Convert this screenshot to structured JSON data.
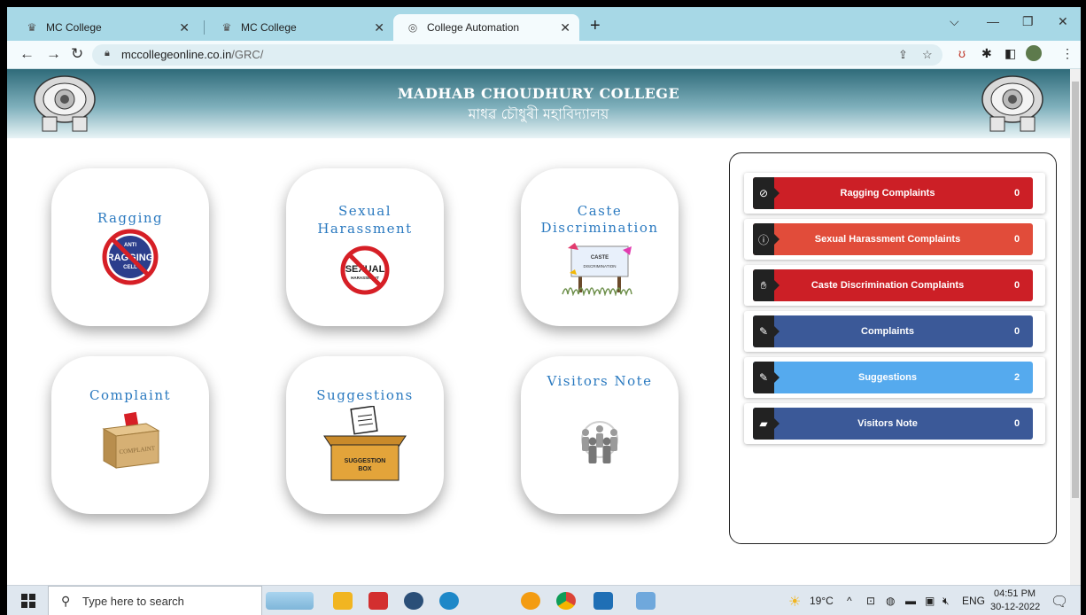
{
  "browser": {
    "tabs": [
      {
        "title": "MC College",
        "active": false
      },
      {
        "title": "MC College",
        "active": false
      },
      {
        "title": "College Automation",
        "active": true
      }
    ],
    "url_host": "mccollegeonline.co.in",
    "url_path": "/GRC/"
  },
  "header": {
    "title": "MADHAB CHOUDHURY COLLEGE",
    "subtitle": "মাধৱ চৌধুৰী মহাবিদ্যালয়"
  },
  "cards": {
    "ragging": {
      "label": "Ragging",
      "badge_top": "ANTI",
      "badge_main": "RAGGING",
      "badge_bottom": "CELL"
    },
    "sexual": {
      "label1": "Sexual",
      "label2": "Harassment",
      "badge_main": "SEXUAL",
      "badge_bottom": "HARASSMENT"
    },
    "caste": {
      "label1": "Caste",
      "label2": "Discrimination",
      "sign1": "CASTE",
      "sign2": "DISCRIMINATION"
    },
    "complaint": {
      "label": "Complaint",
      "box_text": "COMPLAINT"
    },
    "suggestions": {
      "label": "Suggestions",
      "box1": "SUGGESTION",
      "box2": "BOX"
    },
    "visitors": {
      "label": "Visitors Note"
    }
  },
  "summary": [
    {
      "label": "Ragging Complaints",
      "count": "0",
      "icon": "ban-icon",
      "color": "#cc1f26"
    },
    {
      "label": "Sexual Harassment Complaints",
      "count": "0",
      "icon": "info-icon",
      "color": "#e14c3a"
    },
    {
      "label": "Caste Discrimination Complaints",
      "count": "0",
      "icon": "hand-icon",
      "color": "#cc1f26"
    },
    {
      "label": "Complaints",
      "count": "0",
      "icon": "pencil-icon",
      "color": "#3b5998"
    },
    {
      "label": "Suggestions",
      "count": "2",
      "icon": "pencil-icon",
      "color": "#55aaee"
    },
    {
      "label": "Visitors Note",
      "count": "0",
      "icon": "note-icon",
      "color": "#3b5998"
    }
  ],
  "taskbar": {
    "search_placeholder": "Type here to search",
    "weather": "19°C",
    "lang": "ENG",
    "time": "04:51 PM",
    "date": "30-12-2022"
  }
}
